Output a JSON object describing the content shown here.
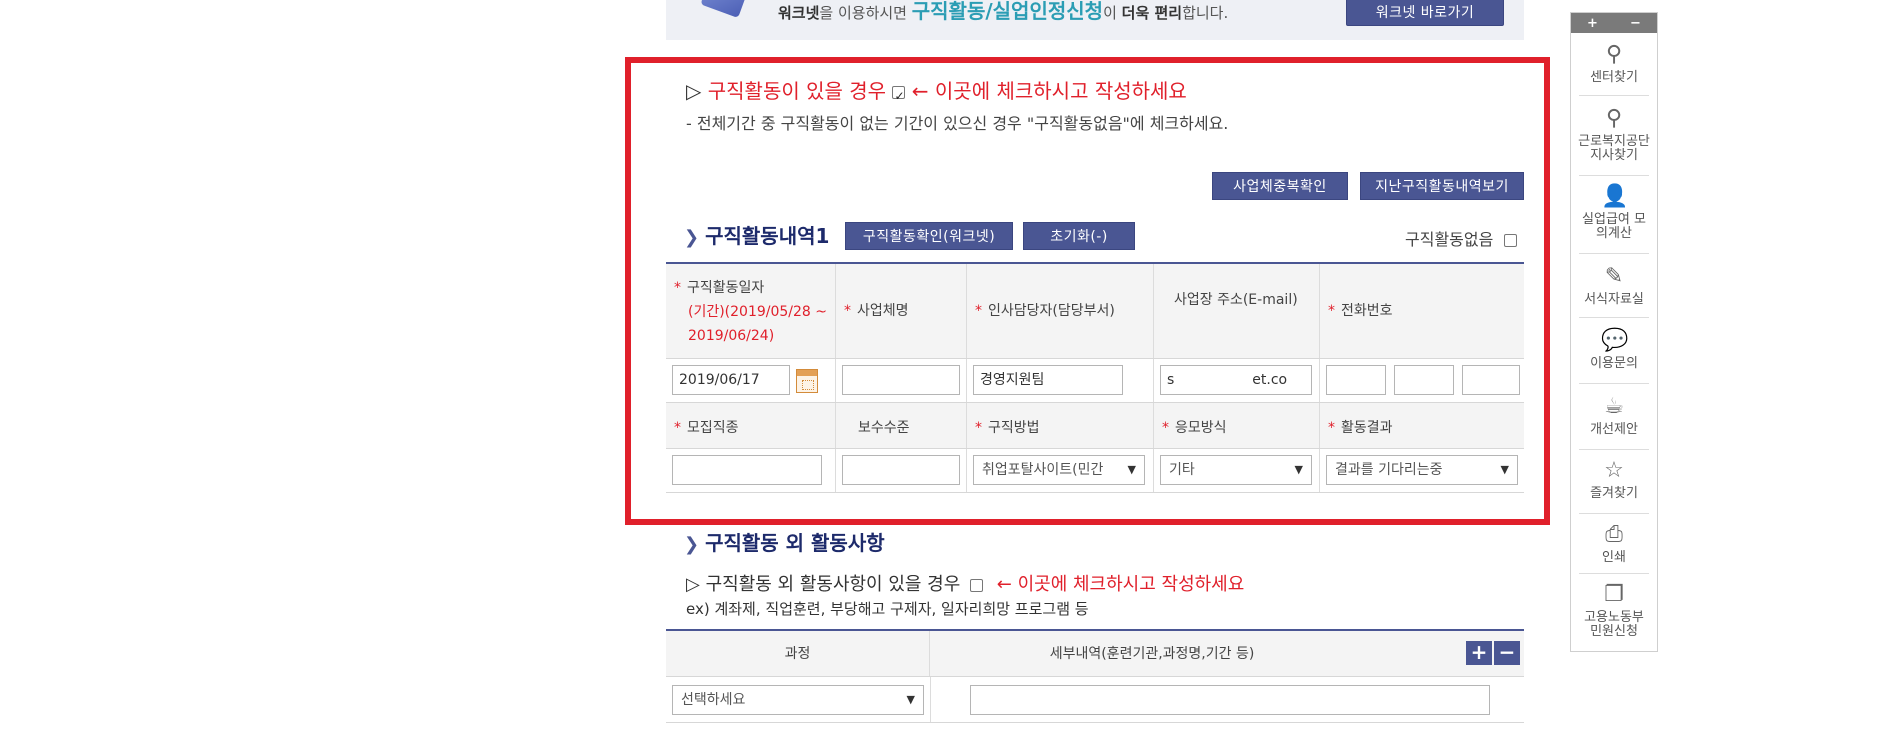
{
  "banner": {
    "text_prefix": "워크넷",
    "text_mid": "을 이용하시면 ",
    "text_highlight": "구직활동/실업인정신청",
    "text_mid2": "이 ",
    "text_bold2": "더욱 편리",
    "text_suffix": "합니다.",
    "button": "워크넷 바로가기"
  },
  "intro": {
    "triangle": "▷",
    "line1": "구직활동이 있을 경우",
    "line1_note": "← 이곳에 체크하시고 작성하세요",
    "line2": "- 전체기간 중 구직활동이 없는 기간이 있으신 경우 \"구직활동없음\"에 체크하세요."
  },
  "top_buttons": {
    "duplicate_check": "사업체중복확인",
    "past_history": "지난구직활동내역보기"
  },
  "job_section": {
    "arrow": "❯",
    "title": "구직활동내역1",
    "confirm_button": "구직활동확인(워크넷)",
    "reset_button": "초기화(-)",
    "no_activity_label": "구직활동없음"
  },
  "grid": {
    "required_mark": "*",
    "date_label": "구직활동일자",
    "date_period": "(기간)(2019/05/28 ~ 2019/06/24)",
    "company_label": "사업체명",
    "manager_label": "인사담당자(담당부서)",
    "email_label": "사업장 주소(E-mail)",
    "phone_label": "전화번호",
    "date_value": "2019/06/17",
    "company_value": "",
    "manager_value": "경영지원팀",
    "email_value_start": "s",
    "email_value_end": "et.co",
    "job_type_label": "모집직종",
    "salary_label": "보수수준",
    "method_label": "구직방법",
    "apply_label": "응모방식",
    "result_label": "활동결과",
    "method_value": "취업포탈사이트(민간",
    "apply_value": "기타",
    "result_value": "결과를 기다리는중",
    "caret": "▼"
  },
  "other_section": {
    "arrow": "❯",
    "title": "구직활동 외 활동사항",
    "triangle": "▷",
    "line1": "구직활동 외 활동사항이 있을 경우",
    "line1_note": "← 이곳에 체크하시고 작성하세요",
    "line2": "ex) 계좌제, 직업훈련, 부당해고 구제자, 일자리희망 프로그램 등",
    "col_course": "과정",
    "col_detail": "세부내역(훈련기관,과정명,기간 등)",
    "plus": "+",
    "minus": "−",
    "select_placeholder": "선택하세요",
    "caret": "▼"
  },
  "quick_menu": {
    "plus": "+",
    "minus": "−",
    "items": [
      {
        "label": "센터찾기",
        "icon": "location-pin-icon",
        "glyph": "📍"
      },
      {
        "label": "근로복지공단 지사찾기",
        "icon": "location-pin-icon",
        "glyph": "📍"
      },
      {
        "label": "실업급여 모의계산",
        "icon": "person-icon",
        "glyph": "👤"
      },
      {
        "label": "서식자료실",
        "icon": "edit-icon",
        "glyph": "✎"
      },
      {
        "label": "이용문의",
        "icon": "chat-icon",
        "glyph": "💬"
      },
      {
        "label": "개선제안",
        "icon": "coffee-icon",
        "glyph": "☕"
      },
      {
        "label": "즐겨찾기",
        "icon": "star-icon",
        "glyph": "☆"
      },
      {
        "label": "인쇄",
        "icon": "print-icon",
        "glyph": "🖶"
      },
      {
        "label": "고용노동부 민원신청",
        "icon": "documents-icon",
        "glyph": "🗐"
      }
    ]
  },
  "colors": {
    "accent_navy": "#4a5693",
    "alert_red": "#e0202b",
    "title_navy": "#1d2a6b"
  }
}
